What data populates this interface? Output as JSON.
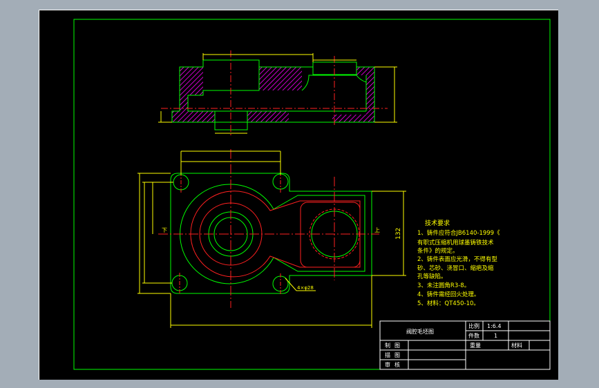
{
  "colors": {
    "background": "#000000",
    "frame": "#00ff00",
    "outline": "#00ff00",
    "centerline": "#ff2020",
    "dimension": "#ffff00",
    "hatch": "#ff00ff",
    "table": "#ffffff",
    "notes": "#ffff00",
    "app_background": "#a3adb7"
  },
  "technical_requirements": {
    "title": "技术要求",
    "lines": [
      "1、铸件应符合JB6140-1999《",
      "有职式压缩机用球墨铸铁技术",
      "条件》的规定。",
      "2、铸件表面应光滑，不得有型",
      "砂、芯砂、浇冒口、缩疤及缩",
      "孔等缺陷。",
      "3、未注圆角R3-8。",
      "4、铸件需经回火处理。",
      "5、材料：QT450-10。"
    ]
  },
  "title_block": {
    "drawing_name": "阀腔毛坯图",
    "scale_label": "比例",
    "scale_value": "1:6.4",
    "quantity_label": "件数",
    "quantity_value": "1",
    "weight_label": "重量",
    "material_label": "材料",
    "drawn_by_label": "制图",
    "traced_by_label": "描图",
    "checked_by_label": "审核"
  },
  "dimensions": {
    "height_right_plan": "132",
    "hole_callout": "4×φ28",
    "section_a_label": "下",
    "section_b_label": "上"
  }
}
